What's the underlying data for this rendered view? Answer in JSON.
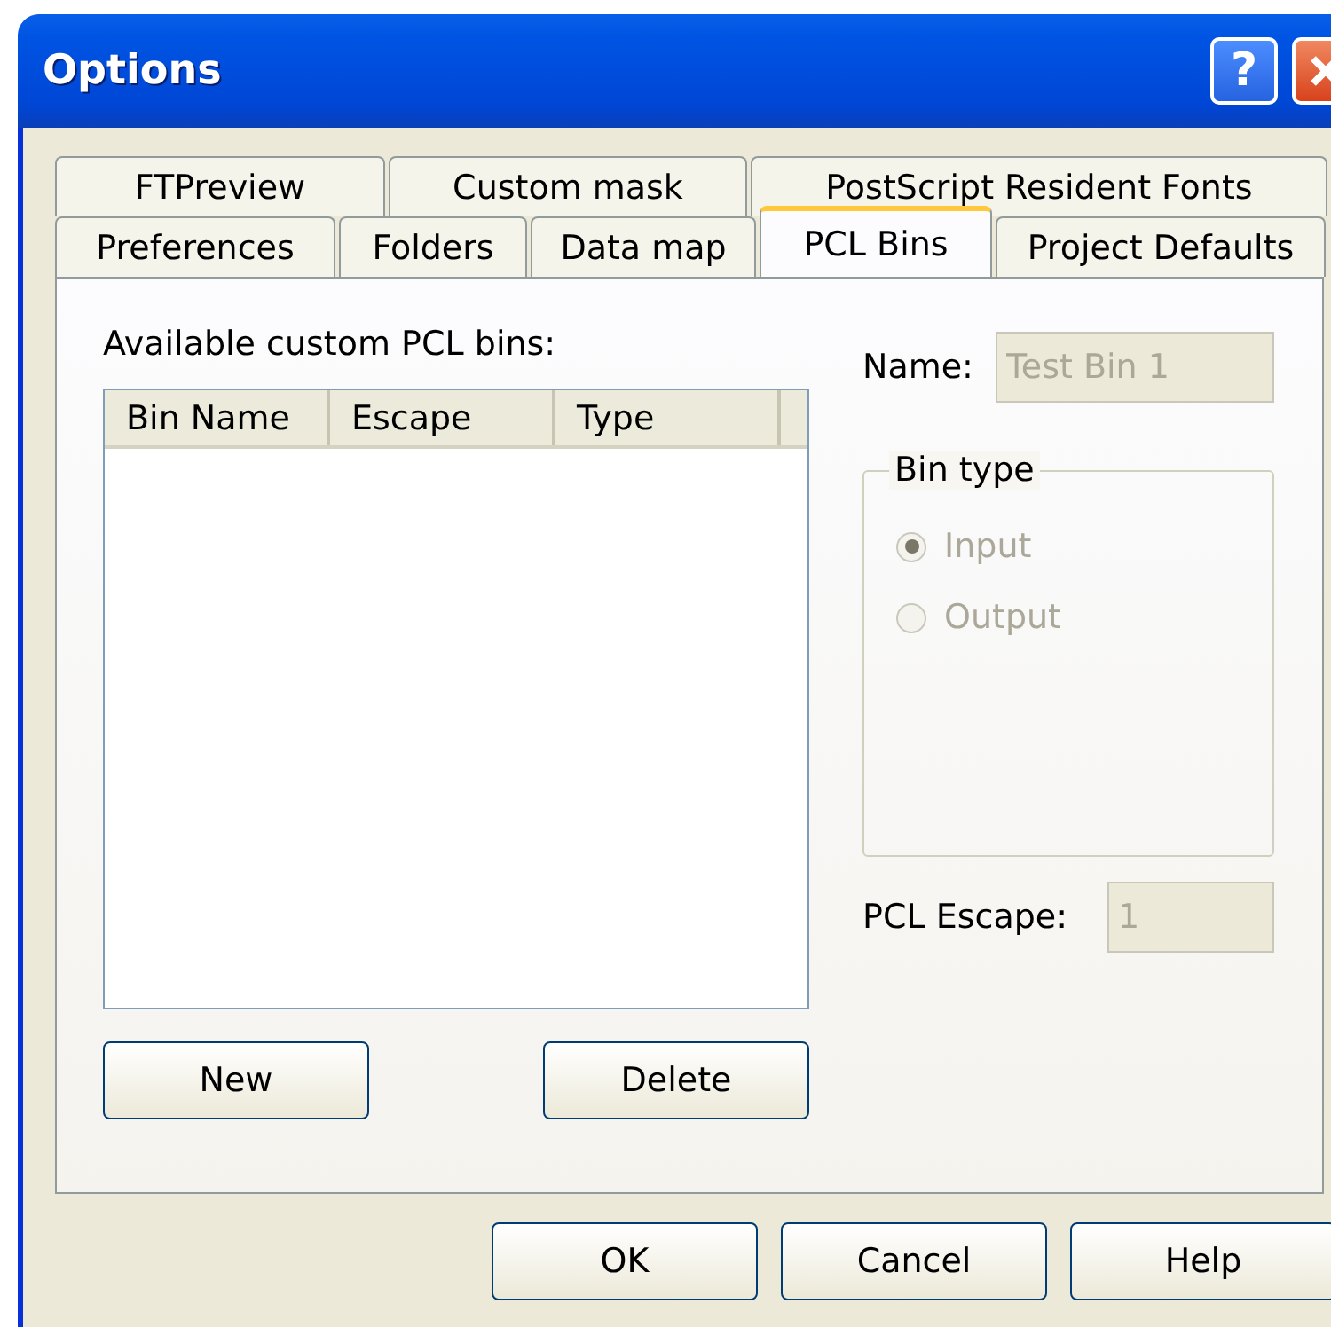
{
  "window": {
    "title": "Options",
    "help_button": "?"
  },
  "tab_rows": [
    {
      "tabs": [
        {
          "label": "FTPreview",
          "selected": false
        },
        {
          "label": "Custom mask",
          "selected": false
        },
        {
          "label": "PostScript Resident Fonts",
          "selected": false
        }
      ]
    },
    {
      "tabs": [
        {
          "label": "Preferences",
          "selected": false
        },
        {
          "label": "Folders",
          "selected": false
        },
        {
          "label": "Data map",
          "selected": false
        },
        {
          "label": "PCL Bins",
          "selected": true
        },
        {
          "label": "Project Defaults",
          "selected": false
        }
      ]
    }
  ],
  "panel": {
    "list_label": "Available custom PCL bins:",
    "list": {
      "columns": [
        "Bin Name",
        "Escape",
        "Type"
      ]
    },
    "name": {
      "label": "Name:",
      "value": "Test Bin 1",
      "disabled": true
    },
    "bin_type": {
      "label": "Bin type",
      "options": [
        {
          "label": "Input",
          "selected": true,
          "disabled": true
        },
        {
          "label": "Output",
          "selected": false,
          "disabled": true
        }
      ]
    },
    "pcl_escape": {
      "label": "PCL Escape:",
      "value": "1",
      "disabled": true
    },
    "buttons": [
      "New",
      "Delete"
    ]
  },
  "buttons": [
    "OK",
    "Cancel",
    "Help"
  ]
}
